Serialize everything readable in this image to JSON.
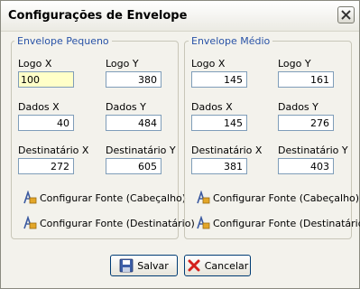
{
  "window": {
    "title": "Configurações de Envelope"
  },
  "groups": {
    "pequeno": {
      "title": "Envelope Pequeno",
      "logo_x_label": "Logo X",
      "logo_x": "100",
      "logo_y_label": "Logo Y",
      "logo_y": "380",
      "dados_x_label": "Dados X",
      "dados_x": "40",
      "dados_y_label": "Dados Y",
      "dados_y": "484",
      "dest_x_label": "Destinatário X",
      "dest_x": "272",
      "dest_y_label": "Destinatário Y",
      "dest_y": "605",
      "font_header": "Configurar Fonte (Cabeçalho)",
      "font_dest": "Configurar Fonte (Destinatário)"
    },
    "medio": {
      "title": "Envelope Médio",
      "logo_x_label": "Logo X",
      "logo_x": "145",
      "logo_y_label": "Logo Y",
      "logo_y": "161",
      "dados_x_label": "Dados X",
      "dados_x": "145",
      "dados_y_label": "Dados Y",
      "dados_y": "276",
      "dest_x_label": "Destinatário X",
      "dest_x": "381",
      "dest_y_label": "Destinatário Y",
      "dest_y": "403",
      "font_header": "Configurar Fonte (Cabeçalho)",
      "font_dest": "Configurar Fonte (Destinatário)"
    }
  },
  "buttons": {
    "save": "Salvar",
    "cancel": "Cancelar"
  },
  "icons": {
    "close": "close-x-icon",
    "font": "font-config-icon",
    "save": "floppy-disk-icon",
    "cancel": "red-x-icon"
  }
}
